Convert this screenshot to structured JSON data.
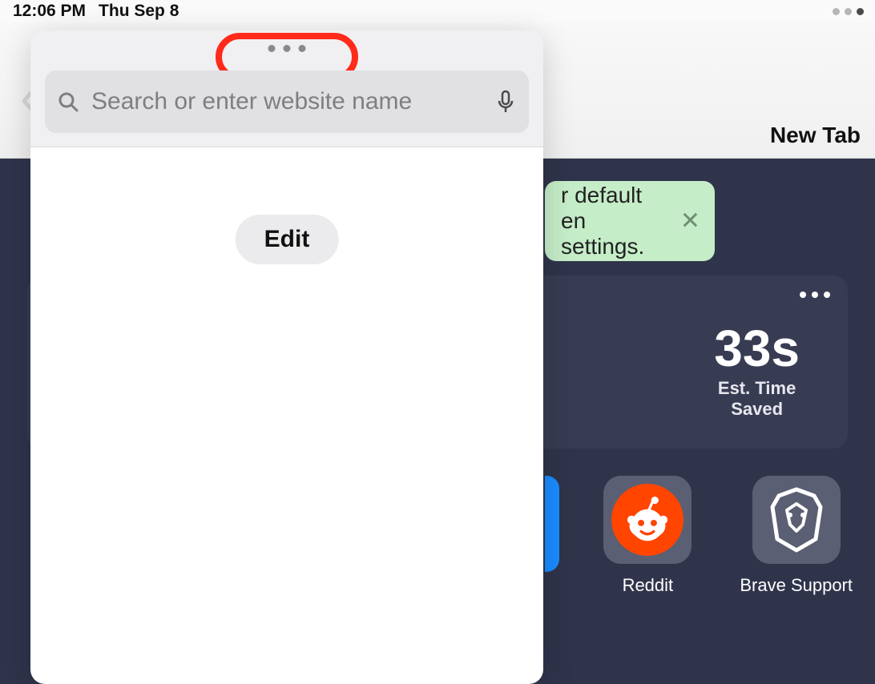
{
  "status": {
    "time": "12:06 PM",
    "date": "Thu Sep 8"
  },
  "toolbar": {
    "new_tab_label": "New Tab"
  },
  "banner": {
    "text_visible": "r default\nen settings."
  },
  "stats": {
    "value": "33s",
    "label": "Est. Time\nSaved"
  },
  "favorites": [
    {
      "name": "Reddit",
      "icon": "reddit-icon",
      "bg": "#5b5f73"
    },
    {
      "name": "Brave Support",
      "icon": "brave-icon",
      "bg": "#5b5f73"
    }
  ],
  "popover": {
    "search_placeholder": "Search or enter website name",
    "edit_label": "Edit"
  }
}
